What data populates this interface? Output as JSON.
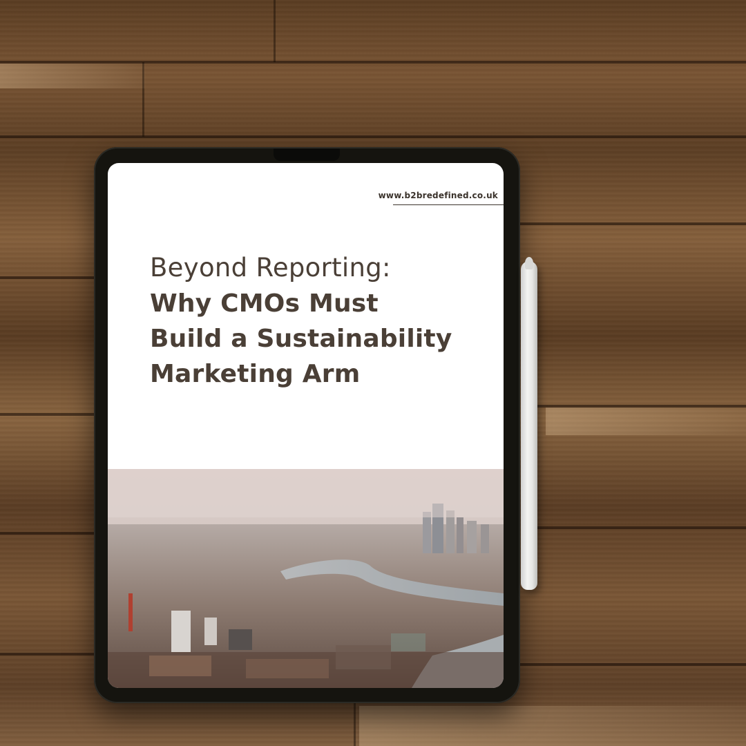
{
  "screen": {
    "site_url": "www.b2bredefined.co.uk",
    "title_light": "Beyond Reporting:",
    "title_bold_lines": [
      "Why CMOs Must",
      "Build a Sustainability",
      "Marketing Arm"
    ]
  },
  "photo": {
    "subject": "aerial-city-skyline-with-river"
  },
  "colors": {
    "title": "#4a3f36",
    "wood": "#6a4a2c",
    "tablet_bezel": "#15140f"
  }
}
